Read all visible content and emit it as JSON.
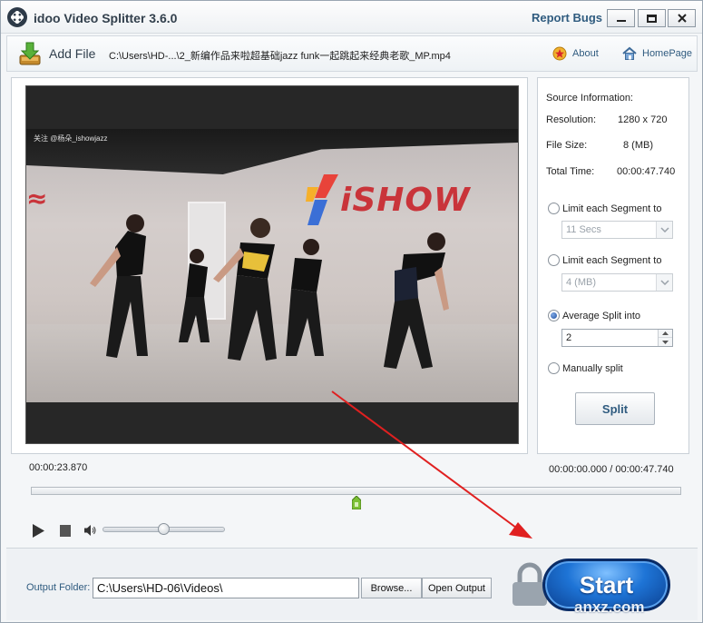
{
  "window": {
    "title": "idoo Video Splitter 3.6.0",
    "report_bugs": "Report Bugs"
  },
  "toolbar": {
    "add_file_label": "Add File",
    "file_path": "C:\\Users\\HD-...\\2_新编作品来啦超基础jazz funk一起跳起来经典老歌_MP.mp4",
    "about_label": "About",
    "homepage_label": "HomePage"
  },
  "video": {
    "watermark": "关注 @杨朵_ishowjazz",
    "brand_text": "iSHOW"
  },
  "source_info": {
    "heading": "Source Information:",
    "resolution_label": "Resolution:",
    "resolution_value": "1280 x 720",
    "file_size_label": "File Size:",
    "file_size_value": "8 (MB)",
    "total_time_label": "Total Time:",
    "total_time_value": "00:00:47.740"
  },
  "split_options": {
    "limit_time_label": "Limit each Segment to",
    "limit_time_value": "11 Secs",
    "limit_size_label": "Limit each Segment to",
    "limit_size_value": "4 (MB)",
    "average_label": "Average Split into",
    "average_value": "2",
    "manual_label": "Manually split",
    "selected": "average",
    "split_button": "Split"
  },
  "timeline": {
    "current_time": "00:00:23.870",
    "range": "00:00:00.000 / 00:00:47.740",
    "marker_fraction": 0.5
  },
  "volume": {
    "level_fraction": 0.5
  },
  "output": {
    "label": "Output Folder:",
    "path": "C:\\Users\\HD-06\\Videos\\",
    "browse_label": "Browse...",
    "open_output_label": "Open Output",
    "start_label": "Start"
  },
  "watermark_site": "anxz.com",
  "colors": {
    "accent_blue": "#2f5b7f",
    "start_blue": "#1e74d6",
    "arrow_red": "#e02020",
    "marker_green": "#7cc034"
  }
}
